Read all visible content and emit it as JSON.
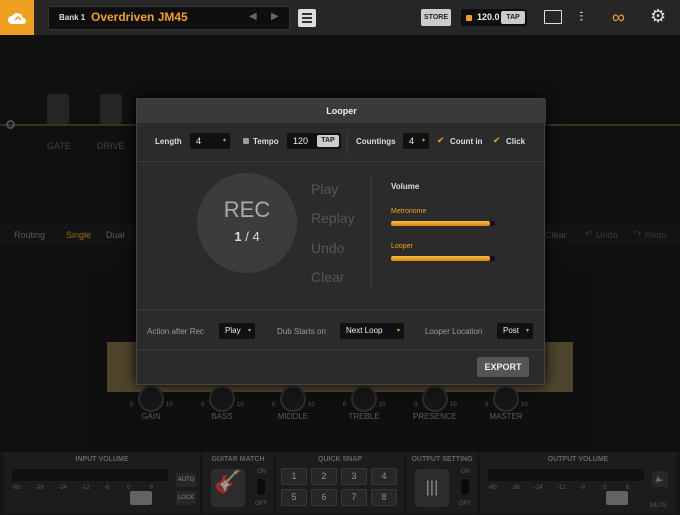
{
  "topbar": {
    "bank": "Bank 1",
    "preset": "Overdriven JM45",
    "store": "STORE",
    "tempo": "120.0",
    "tap": "TAP",
    "accent": "#f0a020"
  },
  "chain": {
    "pedals": [
      "GATE",
      "DRIVE"
    ]
  },
  "routing": {
    "label": "Routing",
    "single": "Single",
    "dual": "Dual",
    "clear": "Clear",
    "undo": "Undo",
    "redo": "Redo"
  },
  "amp": {
    "knobs": [
      "GAIN",
      "BASS",
      "MIDDLE",
      "TREBLE",
      "PRESENCE",
      "MASTER"
    ],
    "scale_min": "0",
    "scale_max": "10"
  },
  "bottom": {
    "input_volume": "INPUT VOLUME",
    "guitar_match": "GUITAR MATCH",
    "quick_snap": "QUICK SNAP",
    "output_setting": "OUTPUT SETTING",
    "output_volume": "OUTPUT VOLUME",
    "auto": "AUTO",
    "lock": "LOCK",
    "on": "ON",
    "off": "OFF",
    "mute": "MUTE",
    "snaps": [
      "1",
      "2",
      "3",
      "4",
      "5",
      "6",
      "7",
      "8"
    ],
    "meter": [
      "-60",
      "-36",
      "-24",
      "-12",
      "-6",
      "0",
      "6"
    ]
  },
  "looper": {
    "title": "Looper",
    "length_label": "Length",
    "length": "4",
    "tempo_label": "Tempo",
    "tempo": "120",
    "tap": "TAP",
    "countings_label": "Countings",
    "countings": "4",
    "count_in": "Count in",
    "click": "Click",
    "rec": "REC",
    "rec_pos": "1",
    "rec_total": "4",
    "slash": "/",
    "actions": [
      "Play",
      "Replay",
      "Undo",
      "Clear"
    ],
    "volume": "Volume",
    "metronome": "Metronome",
    "metronome_level": 0.95,
    "looper_vol": "Looper",
    "looper_level": 0.95,
    "after_rec_label": "Action after Rec",
    "after_rec": "Play",
    "dub_label": "Dub Starts on",
    "dub": "Next Loop",
    "location_label": "Looper Location",
    "location": "Post",
    "export": "EXPORT"
  }
}
